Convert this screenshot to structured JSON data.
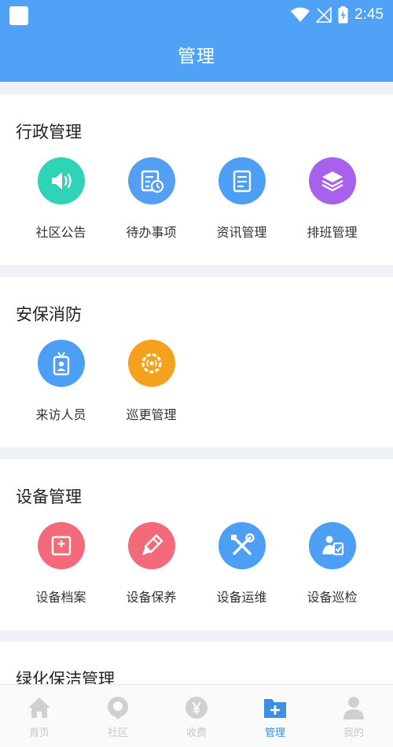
{
  "status_bar": {
    "time": "2:45"
  },
  "header": {
    "title": "管理"
  },
  "sections": [
    {
      "title": "行政管理",
      "items": [
        {
          "label": "社区公告",
          "icon": "speaker-icon",
          "color": "#2fd3b5"
        },
        {
          "label": "待办事项",
          "icon": "schedule-icon",
          "color": "#559ff3"
        },
        {
          "label": "资讯管理",
          "icon": "document-icon",
          "color": "#4d9ef5"
        },
        {
          "label": "排班管理",
          "icon": "layers-icon",
          "color": "#a761ec"
        }
      ]
    },
    {
      "title": "安保消防",
      "items": [
        {
          "label": "来访人员",
          "icon": "id-badge-icon",
          "color": "#4d9ef5"
        },
        {
          "label": "巡更管理",
          "icon": "patrol-gear-icon",
          "color": "#f6a11d"
        }
      ]
    },
    {
      "title": "设备管理",
      "items": [
        {
          "label": "设备档案",
          "icon": "archive-box-icon",
          "color": "#f36b7a"
        },
        {
          "label": "设备保养",
          "icon": "brush-icon",
          "color": "#f36b7a"
        },
        {
          "label": "设备运维",
          "icon": "tools-icon",
          "color": "#4d9ef5"
        },
        {
          "label": "设备巡检",
          "icon": "inspector-icon",
          "color": "#4d9ef5"
        }
      ]
    },
    {
      "title": "绿化保洁管理",
      "items": []
    }
  ],
  "tabs": [
    {
      "label": "首页",
      "icon": "home-icon"
    },
    {
      "label": "社区",
      "icon": "community-icon"
    },
    {
      "label": "收费",
      "icon": "yen-icon"
    },
    {
      "label": "管理",
      "icon": "manage-folder-icon",
      "active": true
    },
    {
      "label": "我的",
      "icon": "profile-icon"
    }
  ],
  "colors": {
    "primary": "#4fa2f6",
    "tab_active": "#3d8fe6",
    "tab_inactive": "#c8c8c8"
  }
}
